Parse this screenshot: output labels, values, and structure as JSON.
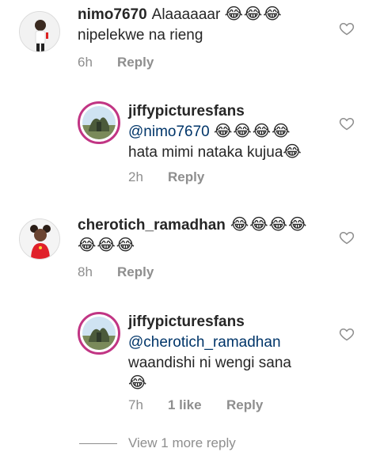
{
  "comments": [
    {
      "username": "nimo7670",
      "text_line1": "Alaaaaaar",
      "emoji_line1": "😂😂😂",
      "text_line2": "nipelekwe na rieng",
      "time": "6h",
      "reply_label": "Reply"
    },
    {
      "username": "jiffypicturesfans",
      "mention": "@nimo7670",
      "emoji_line1": "😂😂😂😂",
      "text_line2": "hata mimi nataka kujua",
      "emoji_line2": "😂",
      "time": "2h",
      "reply_label": "Reply"
    },
    {
      "username": "cherotich_ramadhan",
      "emoji_line1": "😂😂😂😂",
      "emoji_line2": "😂😂😂",
      "time": "8h",
      "reply_label": "Reply"
    },
    {
      "username": "jiffypicturesfans",
      "mention": "@cherotich_ramadhan",
      "text_line2": "waandishi ni wengi sana",
      "emoji_line3": "😂",
      "time": "7h",
      "likes": "1 like",
      "reply_label": "Reply"
    }
  ],
  "view_more": "View 1 more reply",
  "colors": {
    "text": "#262626",
    "secondary": "#8e8e8e",
    "mention": "#003569",
    "story_ring": "#c13584"
  },
  "icons": {
    "like": "heart-outline-icon"
  }
}
